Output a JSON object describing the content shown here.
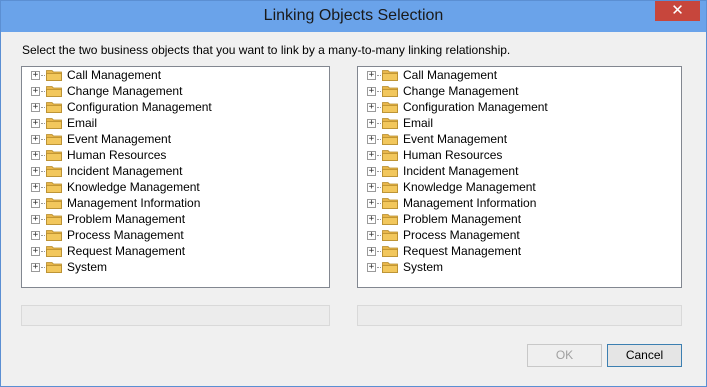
{
  "window": {
    "title": "Linking Objects Selection",
    "close_glyph": "✕"
  },
  "instructions": "Select the two business objects that you want to link by a many-to-many linking relationship.",
  "left_tree": {
    "items": [
      {
        "label": "Call Management",
        "expander": "+"
      },
      {
        "label": "Change Management",
        "expander": "+"
      },
      {
        "label": "Configuration Management",
        "expander": "+"
      },
      {
        "label": "Email",
        "expander": "+"
      },
      {
        "label": "Event Management",
        "expander": "+"
      },
      {
        "label": "Human Resources",
        "expander": "+"
      },
      {
        "label": "Incident Management",
        "expander": "+"
      },
      {
        "label": "Knowledge Management",
        "expander": "+"
      },
      {
        "label": "Management Information",
        "expander": "+"
      },
      {
        "label": "Problem Management",
        "expander": "+"
      },
      {
        "label": "Process Management",
        "expander": "+"
      },
      {
        "label": "Request Management",
        "expander": "+"
      },
      {
        "label": "System",
        "expander": "+"
      }
    ]
  },
  "right_tree": {
    "items": [
      {
        "label": "Call Management",
        "expander": "+"
      },
      {
        "label": "Change Management",
        "expander": "+"
      },
      {
        "label": "Configuration Management",
        "expander": "+"
      },
      {
        "label": "Email",
        "expander": "+"
      },
      {
        "label": "Event Management",
        "expander": "+"
      },
      {
        "label": "Human Resources",
        "expander": "+"
      },
      {
        "label": "Incident Management",
        "expander": "+"
      },
      {
        "label": "Knowledge Management",
        "expander": "+"
      },
      {
        "label": "Management Information",
        "expander": "+"
      },
      {
        "label": "Problem Management",
        "expander": "+"
      },
      {
        "label": "Process Management",
        "expander": "+"
      },
      {
        "label": "Request Management",
        "expander": "+"
      },
      {
        "label": "System",
        "expander": "+"
      }
    ]
  },
  "buttons": {
    "ok_label": "OK",
    "ok_enabled": false,
    "cancel_label": "Cancel"
  },
  "colors": {
    "titlebar": "#6aa3ea",
    "close_button": "#c7463c",
    "folder": "#f2c75c"
  }
}
